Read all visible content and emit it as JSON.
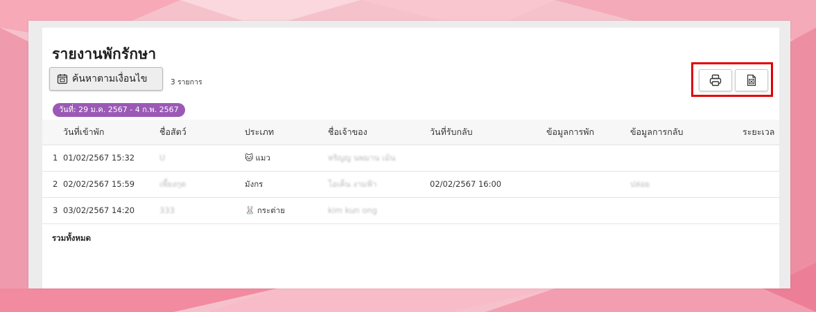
{
  "report": {
    "title": "รายงานพักรักษา",
    "search_button_label": "ค้นหาตามเงื่อนไข",
    "count_text": "3 รายการ",
    "date_badge": "วันที่: 29 ม.ค. 2567 - 4 ก.พ. 2567",
    "total_label": "รวมทั้งหมด"
  },
  "toolbar": {
    "print_icon": "printer-icon",
    "excel_icon": "excel-file-icon",
    "highlight_color": "#e00000"
  },
  "colors": {
    "badge": "#9b59b6",
    "background": "#f3b9c6"
  },
  "table": {
    "headers": [
      "วันที่เข้าพัก",
      "ชื่อสัตว์",
      "ประเภท",
      "ชื่อเจ้าของ",
      "วันที่รับกลับ",
      "ข้อมูลการพัก",
      "ข้อมูลการกลับ",
      "ระยะเวล"
    ],
    "rows": [
      {
        "no": "1",
        "checkin": "01/02/2567 15:32",
        "pet": "U",
        "type_emoji": "🐱",
        "type": "แมว",
        "owner": "หริญญ นพมาน เม้น",
        "pickup": "",
        "stay_info": "",
        "return_info": ""
      },
      {
        "no": "2",
        "checkin": "02/02/2567 15:59",
        "pet": "เพี้ยงกุด",
        "type_emoji": "",
        "type": "มังกร",
        "owner": "โอเค็น งามฟ้า",
        "pickup": "02/02/2567 16:00",
        "stay_info": "",
        "return_info": "ปล่อย"
      },
      {
        "no": "3",
        "checkin": "03/02/2567 14:20",
        "pet": "333",
        "type_emoji": "🐰",
        "type": "กระต่าย",
        "owner": "kim kun ong",
        "pickup": "",
        "stay_info": "",
        "return_info": ""
      }
    ]
  }
}
